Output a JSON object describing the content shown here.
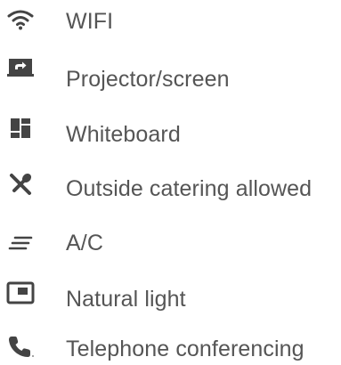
{
  "amenities": {
    "items": [
      {
        "label": "WIFI",
        "icon": "wifi-icon"
      },
      {
        "label": "Projector/screen",
        "icon": "projector-screen-icon"
      },
      {
        "label": "Whiteboard",
        "icon": "whiteboard-icon"
      },
      {
        "label": "Outside catering allowed",
        "icon": "catering-icon"
      },
      {
        "label": "A/C",
        "icon": "air-conditioning-icon"
      },
      {
        "label": "Natural light",
        "icon": "natural-light-icon"
      },
      {
        "label": "Telephone conferencing",
        "icon": "telephone-icon"
      }
    ]
  },
  "colors": {
    "text": "#555555",
    "icon": "#444444",
    "background": "#ffffff"
  }
}
